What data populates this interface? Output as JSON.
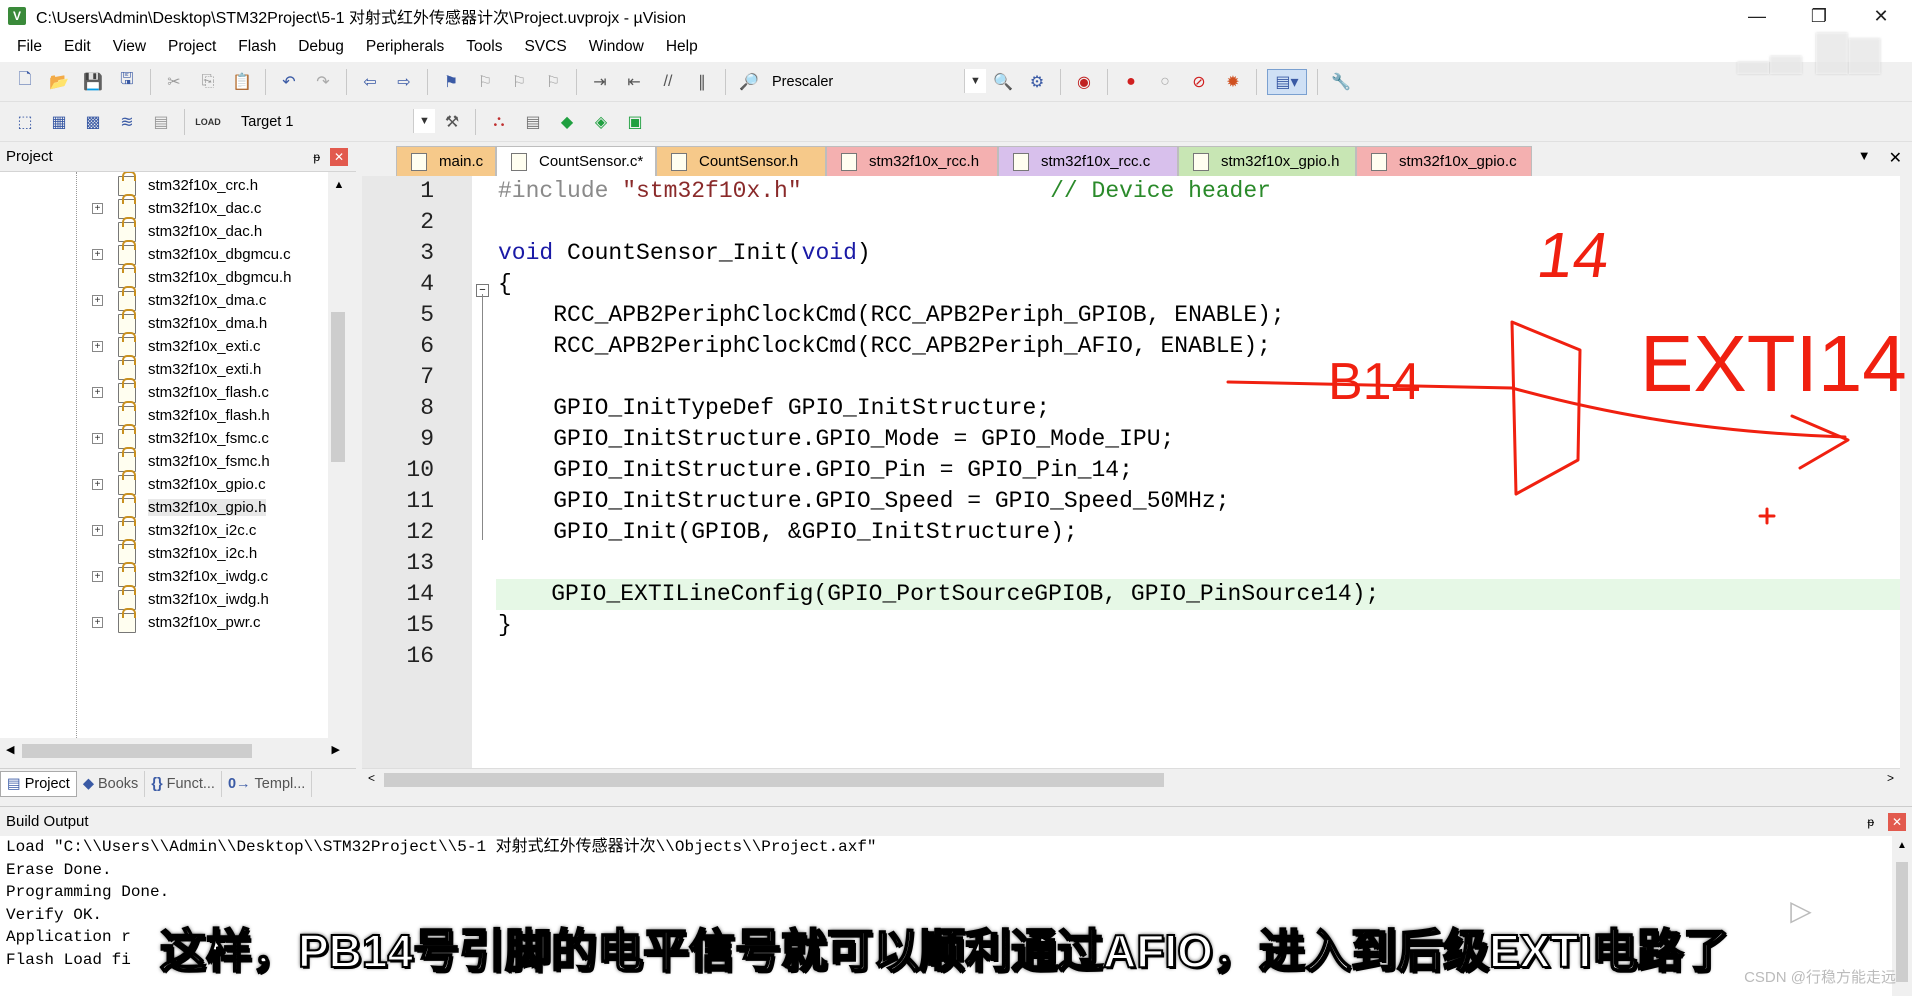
{
  "window": {
    "title": "C:\\Users\\Admin\\Desktop\\STM32Project\\5-1 对射式红外传感器计次\\Project.uvprojx - µVision",
    "app_icon": "V",
    "minimize": "—",
    "restore": "❐",
    "close": "✕"
  },
  "menu": [
    "File",
    "Edit",
    "View",
    "Project",
    "Flash",
    "Debug",
    "Peripherals",
    "Tools",
    "SVCS",
    "Window",
    "Help"
  ],
  "toolbar": {
    "find_combo": "Prescaler",
    "target_combo": "Target 1",
    "load_label": "LOAD"
  },
  "project_pane": {
    "title": "Project",
    "pin": "ᵽ",
    "close": "✕",
    "files": [
      {
        "name": "stm32f10x_crc.h",
        "expandable": false
      },
      {
        "name": "stm32f10x_dac.c",
        "expandable": true
      },
      {
        "name": "stm32f10x_dac.h",
        "expandable": false
      },
      {
        "name": "stm32f10x_dbgmcu.c",
        "expandable": true
      },
      {
        "name": "stm32f10x_dbgmcu.h",
        "expandable": false
      },
      {
        "name": "stm32f10x_dma.c",
        "expandable": true
      },
      {
        "name": "stm32f10x_dma.h",
        "expandable": false
      },
      {
        "name": "stm32f10x_exti.c",
        "expandable": true
      },
      {
        "name": "stm32f10x_exti.h",
        "expandable": false
      },
      {
        "name": "stm32f10x_flash.c",
        "expandable": true
      },
      {
        "name": "stm32f10x_flash.h",
        "expandable": false
      },
      {
        "name": "stm32f10x_fsmc.c",
        "expandable": true
      },
      {
        "name": "stm32f10x_fsmc.h",
        "expandable": false
      },
      {
        "name": "stm32f10x_gpio.c",
        "expandable": true
      },
      {
        "name": "stm32f10x_gpio.h",
        "expandable": false,
        "selected": true
      },
      {
        "name": "stm32f10x_i2c.c",
        "expandable": true
      },
      {
        "name": "stm32f10x_i2c.h",
        "expandable": false
      },
      {
        "name": "stm32f10x_iwdg.c",
        "expandable": true
      },
      {
        "name": "stm32f10x_iwdg.h",
        "expandable": false
      },
      {
        "name": "stm32f10x_pwr.c",
        "expandable": true
      }
    ],
    "tabs": [
      {
        "icon": "▤",
        "label": "Project",
        "active": true
      },
      {
        "icon": "◆",
        "label": "Books",
        "active": false
      },
      {
        "icon": "{}",
        "label": "Funct...",
        "active": false
      },
      {
        "icon": "0→",
        "label": "Templ...",
        "active": false
      }
    ]
  },
  "editor": {
    "tabs": [
      {
        "label": "main.c",
        "color": "#f6c98a",
        "active": false
      },
      {
        "label": "CountSensor.c*",
        "color": "#ffffff",
        "active": true
      },
      {
        "label": "CountSensor.h",
        "color": "#f6c98a",
        "active": false
      },
      {
        "label": "stm32f10x_rcc.h",
        "color": "#f4b0b0",
        "active": false
      },
      {
        "label": "stm32f10x_rcc.c",
        "color": "#d8c0ec",
        "active": false
      },
      {
        "label": "stm32f10x_gpio.h",
        "color": "#c8e6b4",
        "active": false
      },
      {
        "label": "stm32f10x_gpio.c",
        "color": "#f4b0b0",
        "active": false
      }
    ],
    "tab_dropdown": "▼",
    "tab_close": "✕",
    "highlight_line": 14,
    "lines": [
      {
        "n": "1",
        "parts": [
          {
            "t": "#include ",
            "c": "pp"
          },
          {
            "t": "\"stm32f10x.h\"",
            "c": "str"
          },
          {
            "t": "                  ",
            "c": ""
          },
          {
            "t": "// Device header",
            "c": "cmt"
          }
        ]
      },
      {
        "n": "2",
        "parts": []
      },
      {
        "n": "3",
        "parts": [
          {
            "t": "void",
            "c": "kw"
          },
          {
            "t": " CountSensor_Init(",
            "c": ""
          },
          {
            "t": "void",
            "c": "kw"
          },
          {
            "t": ")",
            "c": ""
          }
        ]
      },
      {
        "n": "4",
        "parts": [
          {
            "t": "{",
            "c": ""
          }
        ]
      },
      {
        "n": "5",
        "parts": [
          {
            "t": "    RCC_APB2PeriphClockCmd(RCC_APB2Periph_GPIOB, ENABLE);",
            "c": ""
          }
        ]
      },
      {
        "n": "6",
        "parts": [
          {
            "t": "    RCC_APB2PeriphClockCmd(RCC_APB2Periph_AFIO, ENABLE);",
            "c": ""
          }
        ]
      },
      {
        "n": "7",
        "parts": []
      },
      {
        "n": "8",
        "parts": [
          {
            "t": "    GPIO_InitTypeDef GPIO_InitStructure;",
            "c": ""
          }
        ]
      },
      {
        "n": "9",
        "parts": [
          {
            "t": "    GPIO_InitStructure.GPIO_Mode = GPIO_Mode_IPU;",
            "c": ""
          }
        ]
      },
      {
        "n": "10",
        "parts": [
          {
            "t": "    GPIO_InitStructure.GPIO_Pin = GPIO_Pin_14;",
            "c": ""
          }
        ]
      },
      {
        "n": "11",
        "parts": [
          {
            "t": "    GPIO_InitStructure.GPIO_Speed = GPIO_Speed_50MHz;",
            "c": ""
          }
        ]
      },
      {
        "n": "12",
        "parts": [
          {
            "t": "    GPIO_Init(GPIOB, &GPIO_InitStructure);",
            "c": ""
          }
        ]
      },
      {
        "n": "13",
        "parts": []
      },
      {
        "n": "14",
        "parts": [
          {
            "t": "    GPIO_EXTILineConfig(GPIO_PortSourceGPIOB, GPIO_PinSource14);",
            "c": ""
          }
        ]
      },
      {
        "n": "15",
        "parts": [
          {
            "t": "}",
            "c": ""
          }
        ]
      },
      {
        "n": "16",
        "parts": []
      }
    ]
  },
  "annotations": {
    "color": "#f02010",
    "label_top": "14",
    "label_left": "B14",
    "label_right": "EXTI14",
    "cursor_mark": "+"
  },
  "build_output": {
    "title": "Build Output",
    "lines": [
      "Load \"C:\\\\Users\\\\Admin\\\\Desktop\\\\STM32Project\\\\5-1 对射式红外传感器计次\\\\Objects\\\\Project.axf\"",
      "Erase Done.",
      "Programming Done.",
      "Verify OK.",
      "Application r",
      "Flash Load fi"
    ]
  },
  "overlay": {
    "subtitle": "这样，PB14号引脚的电平信号就可以顺利通过AFIO，进入到后级EXTI电路了",
    "csdn_credit": "CSDN @行稳方能走远"
  }
}
